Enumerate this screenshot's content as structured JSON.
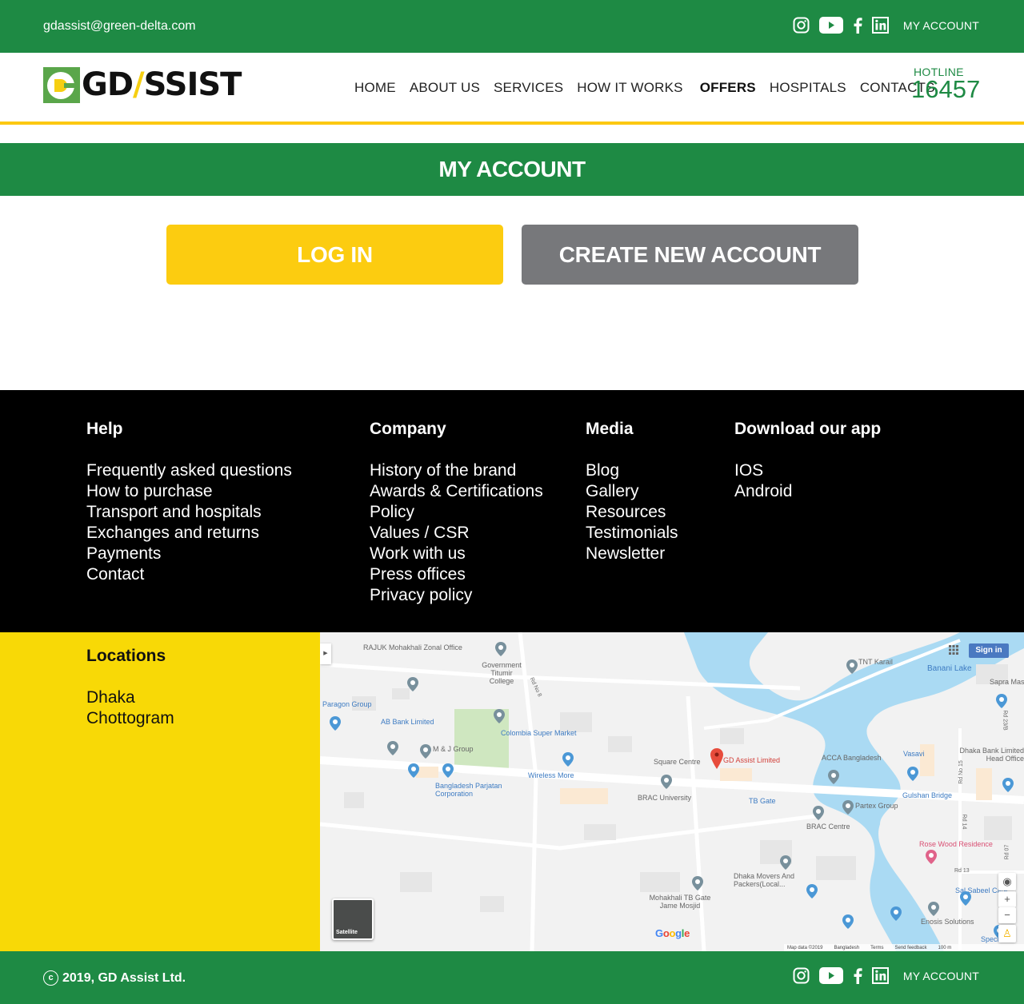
{
  "topbar": {
    "email": "gdassist@green-delta.com",
    "social_icons": [
      "instagram-icon",
      "youtube-icon",
      "facebook-icon",
      "linkedin-icon"
    ],
    "account_link": "MY ACCOUNT"
  },
  "header": {
    "logo_text_pre": "GD",
    "logo_text_post": "SSIST",
    "nav": [
      {
        "label": "HOME",
        "active": false
      },
      {
        "label": "ABOUT US",
        "active": false
      },
      {
        "label": "SERVICES",
        "active": false
      },
      {
        "label": "HOW IT WORKS",
        "active": false
      },
      {
        "label": "OFFERS",
        "active": true
      },
      {
        "label": "HOSPITALS",
        "active": false
      },
      {
        "label": "CONTACTS",
        "active": false
      }
    ],
    "hotline_label": "HOTLINE",
    "hotline_number": "16457"
  },
  "page": {
    "title": "MY ACCOUNT",
    "login_button": "LOG IN",
    "create_button": "CREATE NEW ACCOUNT"
  },
  "footer": {
    "columns": [
      {
        "heading": "Help",
        "links": [
          "Frequently asked questions",
          "How to purchase",
          "Transport and hospitals",
          "Exchanges and returns",
          "Payments",
          "Contact"
        ]
      },
      {
        "heading": "Company",
        "links": [
          "History of the brand",
          "Awards & Certifications",
          "Policy",
          "Values / CSR",
          "Work with us",
          "Press offices",
          "Privacy policy"
        ]
      },
      {
        "heading": "Media",
        "links": [
          "Blog",
          "Gallery",
          "Resources",
          "Testimonials",
          "Newsletter"
        ]
      },
      {
        "heading": "Download our app",
        "links": [
          "IOS",
          "Android"
        ]
      }
    ],
    "locations": {
      "heading": "Locations",
      "items": [
        "Dhaka",
        "Chottogram"
      ]
    }
  },
  "map": {
    "sign_in": "Sign in",
    "satellite_label": "Satellite",
    "google_logo": "Google",
    "marker_label": "GD Assist Limited",
    "places": [
      "RAJUK Mohakhali Zonal Office",
      "Government Titumir College",
      "Rd No 8",
      "Paragon Group",
      "AB Bank Limited",
      "M & J Group",
      "Colombia Super Market",
      "Wireless More",
      "Bangladesh Parjatan Corporation",
      "Square Centre",
      "BRAC University",
      "TB Gate",
      "TNT Karail",
      "Banani Lake",
      "Sapra Masjid",
      "Rd 23/B",
      "ACCA Bangladesh",
      "Vasavi",
      "Rd No 15",
      "Dhaka Bank Limited Head Office",
      "Gulshan Bridge",
      "Partex Group",
      "BRAC Centre",
      "Rd 14",
      "Rose Wood Residence",
      "Rd 07",
      "Rd 13",
      "Dhaka Movers And Packers(Local...",
      "Mohakhali TB Gate Jame Mosjid",
      "Sal Sabeel Care",
      "Enosis Solutions",
      "Specia..."
    ],
    "attribution": [
      "Map data ©2019",
      "Bangladesh",
      "Terms",
      "Send feedback",
      "100 m"
    ]
  },
  "bottombar": {
    "copyright_symbol": "c",
    "copyright": "2019, GD Assist Ltd.",
    "account_link": "MY ACCOUNT"
  },
  "colors": {
    "brand_green": "#1e8a44",
    "brand_yellow": "#fccc10",
    "locations_yellow": "#f8d906",
    "secondary_gray": "#77787b"
  }
}
